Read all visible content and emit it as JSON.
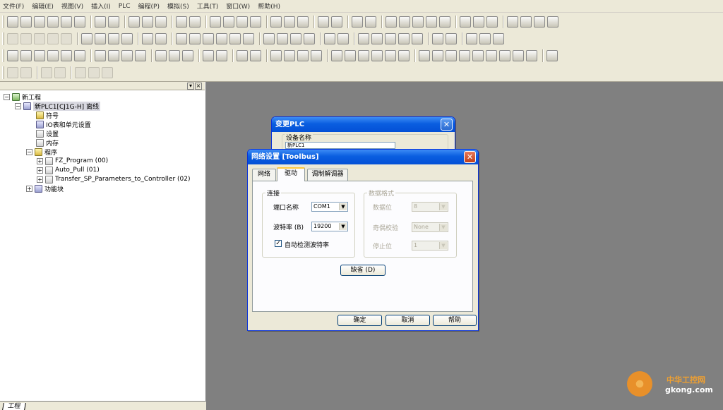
{
  "menu": [
    "文件(F)",
    "编辑(E)",
    "视图(V)",
    "插入(I)",
    "PLC",
    "编程(P)",
    "模拟(S)",
    "工具(T)",
    "窗口(W)",
    "帮助(H)"
  ],
  "tree": {
    "root": "新工程",
    "plc": "新PLC1[CJ1G-H] 离线",
    "symbols": "符号",
    "io_table": "IO表和单元设置",
    "settings": "设置",
    "memory": "内存",
    "programs": "程序",
    "program_items": [
      "FZ_Program (00)",
      "Auto_Pull (01)",
      "Transfer_SP_Parameters_to_Controller (02)"
    ],
    "function_blocks": "功能块",
    "tab": "工程"
  },
  "dialog_change_plc": {
    "title": "变更PLC",
    "device_name_label": "设备名称",
    "device_name_value": "新PLC1"
  },
  "dialog_network": {
    "title": "网络设置 [Toolbus]",
    "tabs": [
      "网络",
      "驱动",
      "调制解调器"
    ],
    "active_tab": "驱动",
    "connection": {
      "group_label": "连接",
      "port_label": "端口名称",
      "port_value": "COM1",
      "baud_label": "波特率 (B)",
      "baud_value": "19200",
      "auto_detect_label": "自动检测波特率",
      "auto_detect_checked": true
    },
    "data_format": {
      "group_label": "数据格式",
      "data_bits_label": "数据位",
      "data_bits_value": "8",
      "parity_label": "奇偶校验",
      "parity_value": "None",
      "stop_bits_label": "停止位",
      "stop_bits_value": "1"
    },
    "default_button": "缺省 (D)",
    "ok_button": "确定",
    "cancel_button": "取消",
    "help_button": "帮助"
  },
  "watermark": {
    "cn": "中华工控网",
    "url": "gkong.com"
  }
}
